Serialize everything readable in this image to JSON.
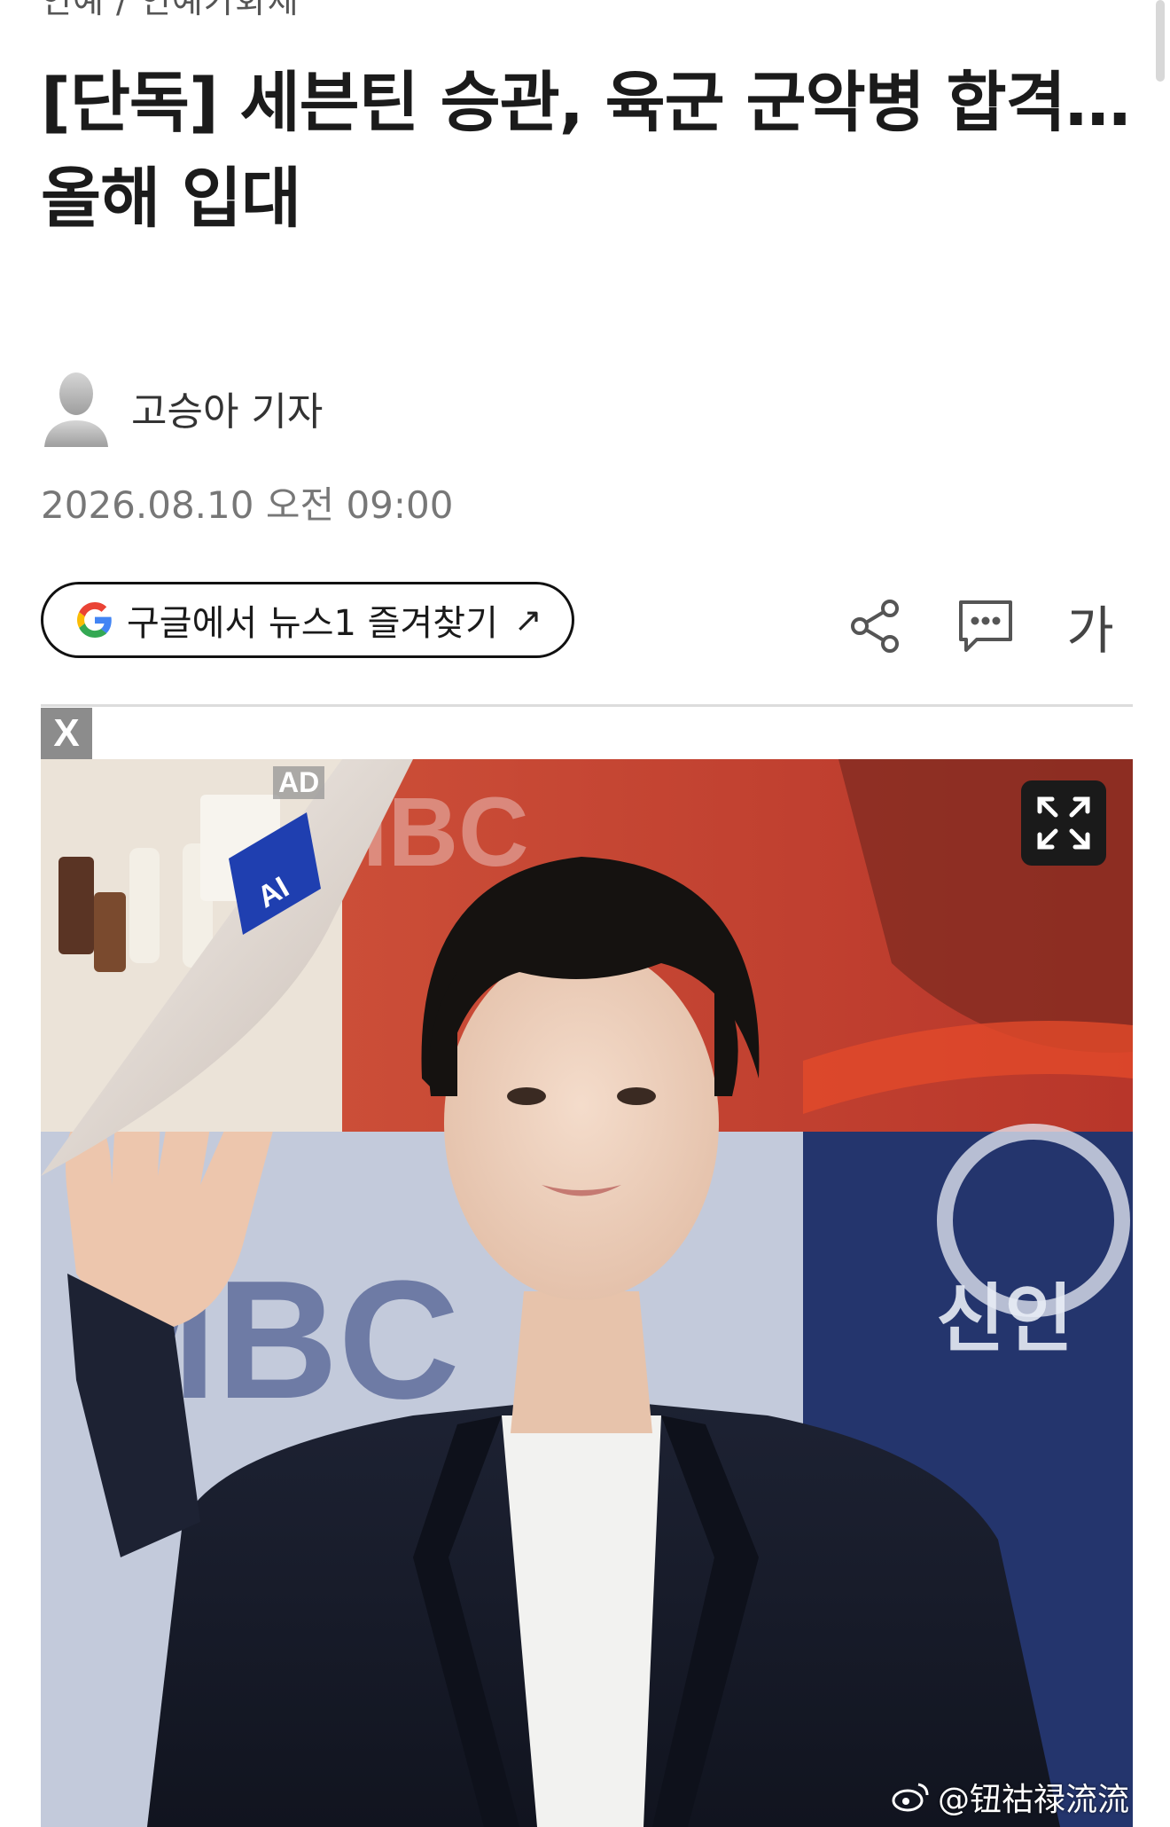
{
  "breadcrumb": {
    "items": [
      "연예",
      "연예가화제"
    ],
    "separator": "/"
  },
  "article": {
    "title": "[단독] 세븐틴 승관, 육군 군악병 합격… 올해 입대",
    "author": "고승아 기자",
    "datetime": "2026.08.10 오전 09:00"
  },
  "actions": {
    "google_follow_label": "구글에서 뉴스1 즐겨찾기",
    "google_follow_arrow": "↗",
    "share_icon": "share-icon",
    "comment_icon": "comment-icon",
    "font_size_label": "가"
  },
  "ad": {
    "close_label": "X",
    "ad_label": "AD",
    "ai_badge": "AI"
  },
  "photo": {
    "expand_icon": "expand-icon",
    "watermark": "@钮祜禄流流"
  },
  "colors": {
    "headline": "#1b1b1b",
    "meta": "#777777",
    "divider": "#dcdcdc",
    "ad_close_bg": "#8c8c8c",
    "backdrop_red": "#c8402c",
    "backdrop_blue": "#1e2f66",
    "ai_badge_blue": "#1f3fb0"
  }
}
